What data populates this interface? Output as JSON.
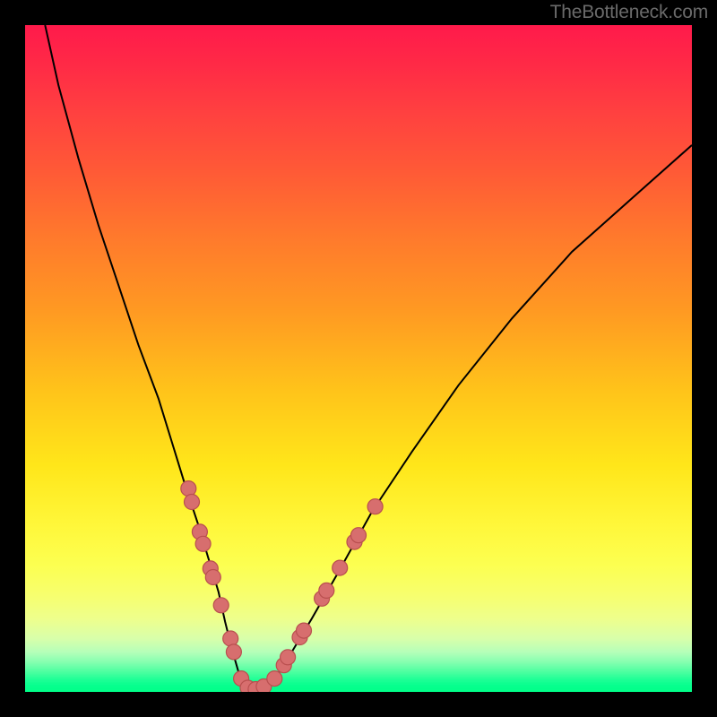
{
  "watermark": "TheBottleneck.com",
  "chart_data": {
    "type": "line",
    "title": "",
    "xlabel": "",
    "ylabel": "",
    "xlim": [
      0,
      100
    ],
    "ylim": [
      0,
      100
    ],
    "grid": false,
    "legend": false,
    "background": "rainbow-vertical-gradient",
    "series": [
      {
        "name": "bottleneck-curve",
        "x": [
          3,
          5,
          8,
          11,
          14,
          17,
          20,
          22,
          24,
          26,
          27.5,
          29,
          30,
          31,
          32,
          33,
          34,
          36,
          38,
          40,
          43,
          47,
          52,
          58,
          65,
          73,
          82,
          91,
          100
        ],
        "y": [
          100,
          91,
          80,
          70,
          61,
          52,
          44,
          37.5,
          31,
          25,
          20,
          15,
          10.5,
          6.5,
          3,
          1,
          0.2,
          0.8,
          2.8,
          6,
          11,
          18,
          27,
          36,
          46,
          56,
          66,
          74,
          82
        ]
      }
    ],
    "scatter_points": {
      "name": "highlight-dots",
      "points": [
        {
          "x": 24.5,
          "y": 30.5
        },
        {
          "x": 25.0,
          "y": 28.5
        },
        {
          "x": 26.2,
          "y": 24.0
        },
        {
          "x": 26.7,
          "y": 22.2
        },
        {
          "x": 27.8,
          "y": 18.5
        },
        {
          "x": 28.2,
          "y": 17.2
        },
        {
          "x": 29.4,
          "y": 13.0
        },
        {
          "x": 30.8,
          "y": 8.0
        },
        {
          "x": 31.3,
          "y": 6.0
        },
        {
          "x": 32.4,
          "y": 2.0
        },
        {
          "x": 33.4,
          "y": 0.6
        },
        {
          "x": 34.6,
          "y": 0.4
        },
        {
          "x": 35.8,
          "y": 0.8
        },
        {
          "x": 37.4,
          "y": 2.0
        },
        {
          "x": 38.8,
          "y": 4.0
        },
        {
          "x": 39.4,
          "y": 5.2
        },
        {
          "x": 41.2,
          "y": 8.2
        },
        {
          "x": 41.8,
          "y": 9.2
        },
        {
          "x": 44.5,
          "y": 14.0
        },
        {
          "x": 45.2,
          "y": 15.2
        },
        {
          "x": 47.2,
          "y": 18.6
        },
        {
          "x": 49.4,
          "y": 22.5
        },
        {
          "x": 50.0,
          "y": 23.5
        },
        {
          "x": 52.5,
          "y": 27.8
        }
      ]
    }
  }
}
